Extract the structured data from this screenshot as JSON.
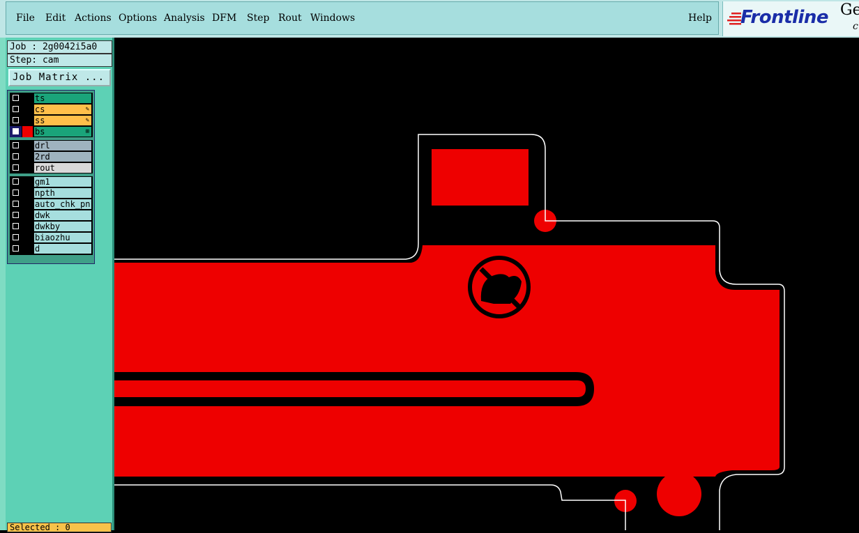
{
  "menubar": {
    "items": [
      {
        "label": "File"
      },
      {
        "label": "Edit"
      },
      {
        "label": "Actions"
      },
      {
        "label": "Options"
      },
      {
        "label": "Analysis"
      },
      {
        "label": "DFM"
      },
      {
        "label": "Step"
      },
      {
        "label": "Rout"
      },
      {
        "label": "Windows"
      }
    ],
    "help": "Help"
  },
  "logo": {
    "word": "Frontline",
    "partial_right": "Ge",
    "partial_small": "c"
  },
  "job": {
    "label": "Job : 2g0042i5a0"
  },
  "step": {
    "label": "Step: cam"
  },
  "job_matrix_button": "Job Matrix ...",
  "layers": [
    {
      "name": "ts",
      "color": "#1aa47a",
      "tag": ""
    },
    {
      "name": "cs",
      "color": "#ffbf4a",
      "tag": "✎"
    },
    {
      "name": "ss",
      "color": "#ffbf4a",
      "tag": "✎"
    },
    {
      "name": "bs",
      "color": "#1aa47a",
      "tag": "⊞",
      "active": true,
      "display_color": "#ee0000"
    },
    {
      "name": "drl",
      "color": "#9fb3bf",
      "tag": ""
    },
    {
      "name": "2rd",
      "color": "#9fb3bf",
      "tag": ""
    },
    {
      "name": "rout",
      "color": "#d9d9d9",
      "tag": ""
    },
    {
      "name": "gm1",
      "color": "#a6dede",
      "tag": ""
    },
    {
      "name": "npth",
      "color": "#a6dede",
      "tag": ""
    },
    {
      "name": "auto_chk_pn",
      "color": "#a6dede",
      "tag": ""
    },
    {
      "name": "dwk",
      "color": "#a6dede",
      "tag": ""
    },
    {
      "name": "dwkby",
      "color": "#a6dede",
      "tag": ""
    },
    {
      "name": "biaozhu",
      "color": "#a6dede",
      "tag": ""
    },
    {
      "name": "d",
      "color": "#a6dede",
      "tag": ""
    }
  ],
  "status": {
    "selected": "Selected : 0"
  },
  "colors": {
    "copper": "#ee0000",
    "outline": "#ffffff",
    "background": "#000000"
  }
}
